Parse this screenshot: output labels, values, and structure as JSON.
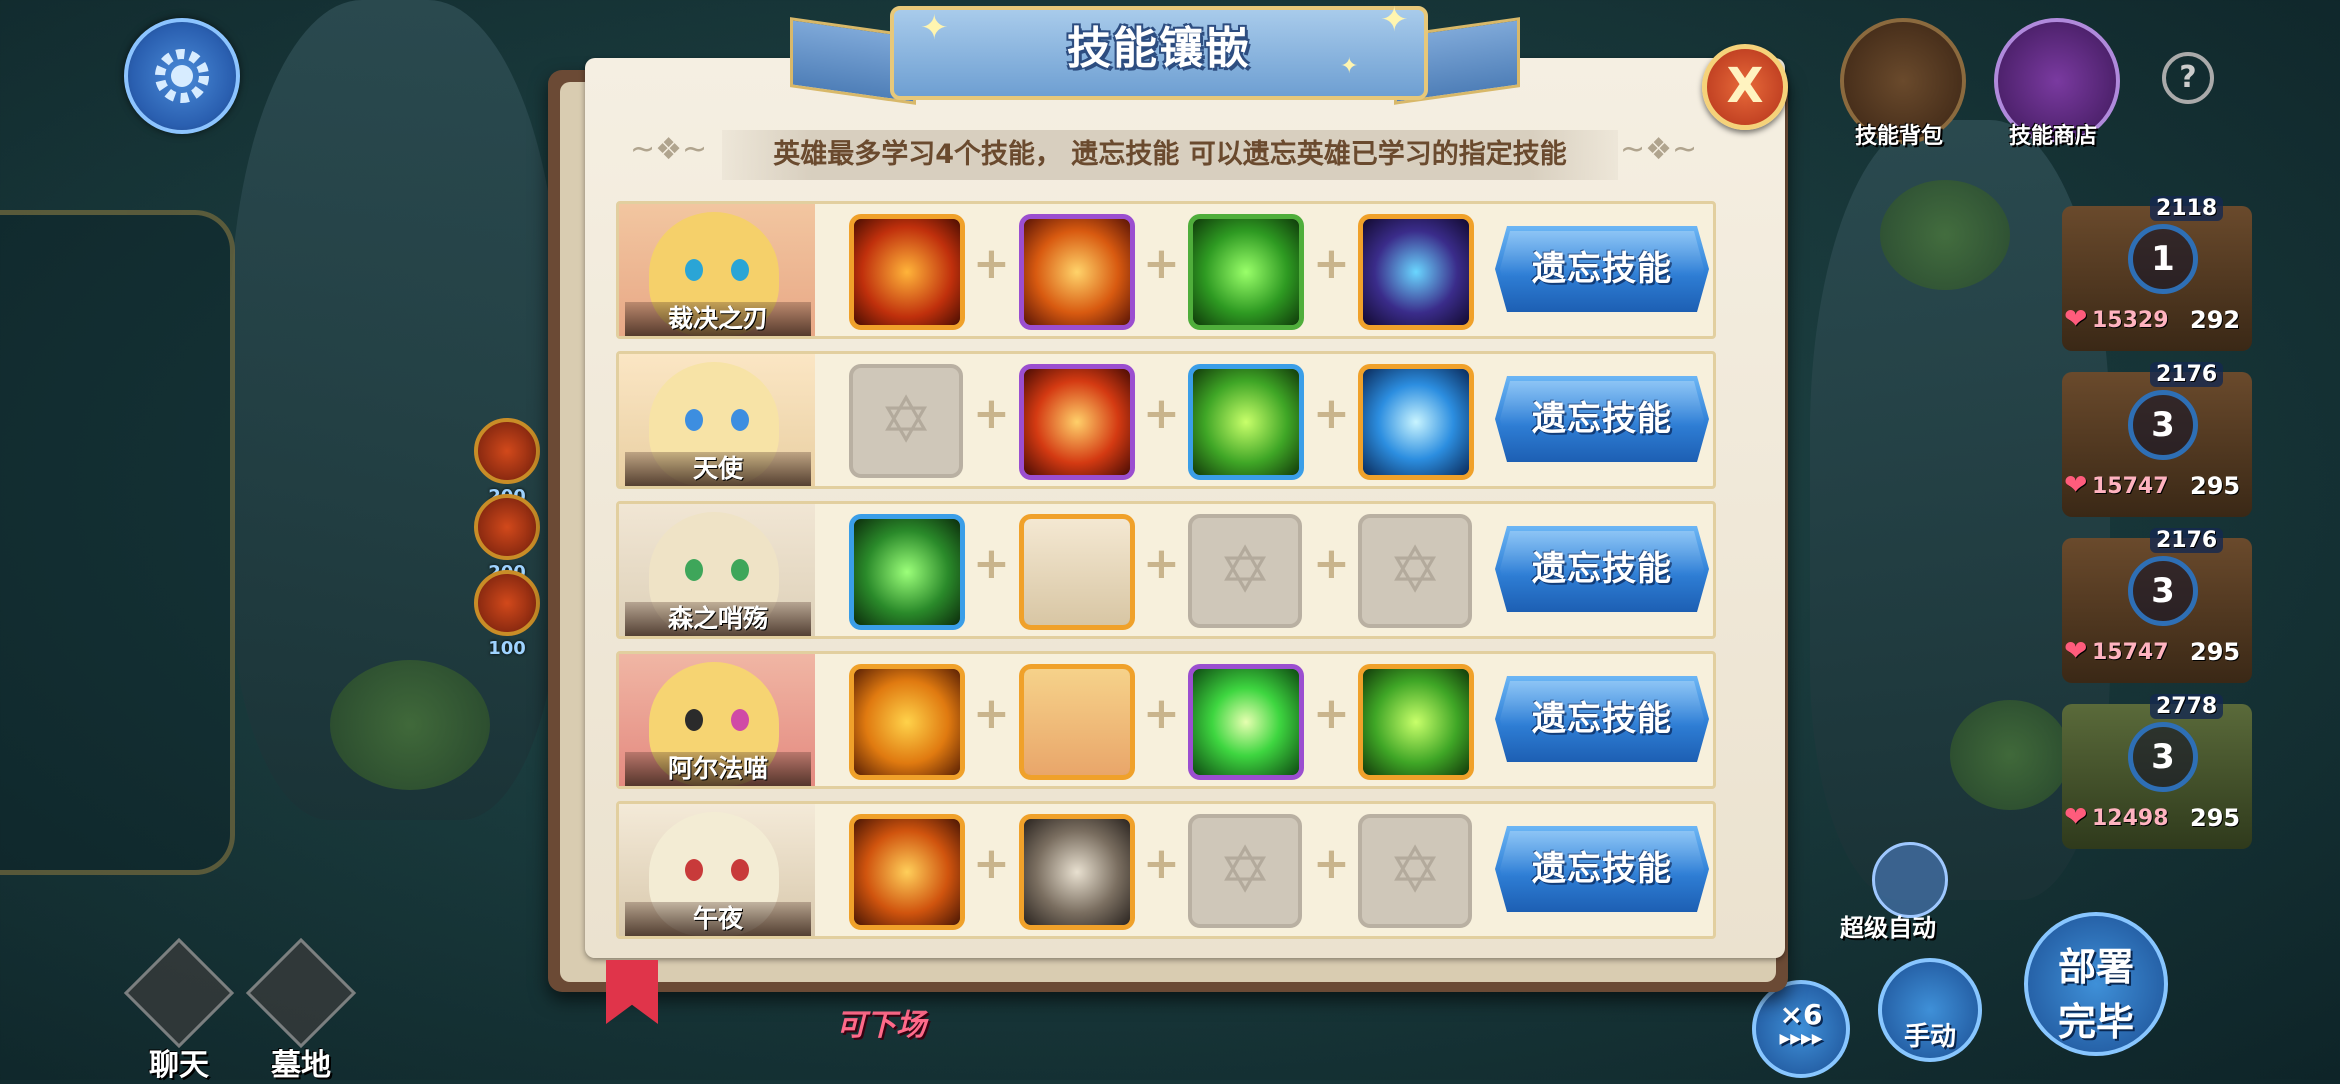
{
  "dialog": {
    "title": "技能镶嵌",
    "close_label": "X",
    "info": "英雄最多学习4个技能，  遗忘技能  可以遗忘英雄已学习的指定技能"
  },
  "heroes": [
    {
      "name": "裁决之刃",
      "button": "遗忘技能",
      "skills": [
        {
          "icon": "fire-hooded-figure-icon",
          "frame": "orange"
        },
        {
          "icon": "fire-totem-icon",
          "frame": "purple"
        },
        {
          "icon": "green-matrix-figure-icon",
          "frame": "green"
        },
        {
          "icon": "dark-horned-knight-icon",
          "frame": "orange"
        }
      ]
    },
    {
      "name": "天使",
      "button": "遗忘技能",
      "skills": [
        {
          "icon": "empty-slot-icon",
          "frame": "empty"
        },
        {
          "icon": "fire-heal-figure-icon",
          "frame": "purple"
        },
        {
          "icon": "green-crossed-blades-icon",
          "frame": "blue"
        },
        {
          "icon": "blue-energy-orb-icon",
          "frame": "orange"
        }
      ]
    },
    {
      "name": "森之哨殇",
      "button": "遗忘技能",
      "skills": [
        {
          "icon": "green-spirit-hand-icon",
          "frame": "blue"
        },
        {
          "icon": "elf-portrait-icon",
          "frame": "orange"
        },
        {
          "icon": "empty-slot-icon",
          "frame": "empty"
        },
        {
          "icon": "empty-slot-icon",
          "frame": "empty"
        }
      ]
    },
    {
      "name": "阿尔法喵",
      "button": "遗忘技能",
      "skills": [
        {
          "icon": "fire-sun-figure-icon",
          "frame": "orange"
        },
        {
          "icon": "cat-girl-portrait-icon",
          "frame": "orange"
        },
        {
          "icon": "green-energy-burst-icon",
          "frame": "purple"
        },
        {
          "icon": "green-crossed-blades-icon",
          "frame": "orange"
        }
      ]
    },
    {
      "name": "午夜",
      "button": "遗忘技能",
      "skills": [
        {
          "icon": "fire-slash-icon",
          "frame": "orange"
        },
        {
          "icon": "stone-armor-icon",
          "frame": "orange"
        },
        {
          "icon": "empty-slot-icon",
          "frame": "empty"
        },
        {
          "icon": "empty-slot-icon",
          "frame": "empty"
        }
      ]
    }
  ],
  "top_right": {
    "bag_label": "技能背包",
    "shop_label": "技能商店",
    "help": "?"
  },
  "left_costs": [
    "200",
    "200",
    "100"
  ],
  "bottom_left": {
    "chat": "聊天",
    "graveyard": "墓地"
  },
  "deploy_hint": "可下场",
  "roster": [
    {
      "power": "2118",
      "level": "1",
      "hp": "15329",
      "extra": "292"
    },
    {
      "power": "2176",
      "level": "3",
      "hp": "15747",
      "extra": "295"
    },
    {
      "power": "2176",
      "level": "3",
      "hp": "15747",
      "extra": "295"
    },
    {
      "power": "2778",
      "level": "3",
      "hp": "12498",
      "extra": "295"
    }
  ],
  "bottom_right": {
    "super_auto": "超级自动",
    "speed": "×6",
    "speed_arrows": "▶▶▶▶",
    "manual": "手动",
    "deploy_line1": "部署",
    "deploy_line2": "完毕"
  },
  "colors": {
    "accent_blue": "#2f7fd6",
    "frame_orange": "#f0a12a",
    "frame_purple": "#9b4ed0",
    "close_red": "#b3321a"
  }
}
